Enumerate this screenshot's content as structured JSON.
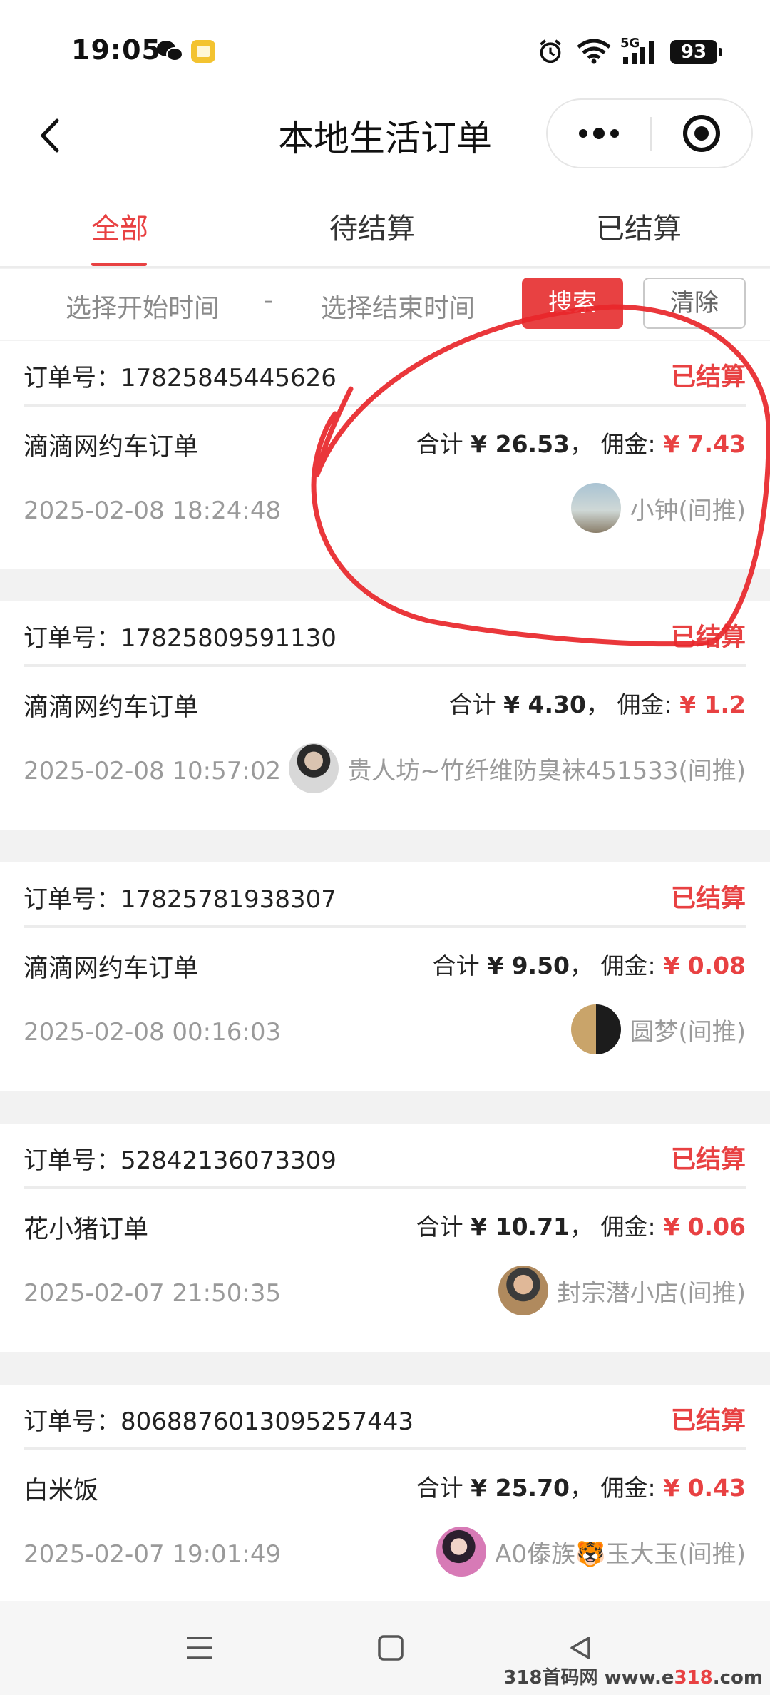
{
  "status_bar": {
    "time": "19:05",
    "network": "5G",
    "battery": "93"
  },
  "nav": {
    "title": "本地生活订单"
  },
  "tabs": [
    {
      "label": "全部",
      "active": true
    },
    {
      "label": "待结算",
      "active": false
    },
    {
      "label": "已结算",
      "active": false
    }
  ],
  "filter": {
    "start_placeholder": "选择开始时间",
    "separator": "-",
    "end_placeholder": "选择结束时间",
    "search_label": "搜索",
    "clear_label": "清除"
  },
  "labels": {
    "order_no": "订单号：",
    "total": "合计 ",
    "commission": "， 佣金: "
  },
  "orders": [
    {
      "order_no": "17825845445626",
      "status": "已结算",
      "name": "滴滴网约车订单",
      "total": "¥ 26.53",
      "commission": "¥ 7.43",
      "time": "2025-02-08 18:24:48",
      "user": "小钟(间推)"
    },
    {
      "order_no": "17825809591130",
      "status": "已结算",
      "name": "滴滴网约车订单",
      "total": "¥ 4.30",
      "commission": "¥ 1.2",
      "time": "2025-02-08 10:57:02",
      "user": "贵人坊~竹纤维防臭袜451533(间推)"
    },
    {
      "order_no": "17825781938307",
      "status": "已结算",
      "name": "滴滴网约车订单",
      "total": "¥ 9.50",
      "commission": "¥ 0.08",
      "time": "2025-02-08 00:16:03",
      "user": "圆梦(间推)"
    },
    {
      "order_no": "52842136073309",
      "status": "已结算",
      "name": "花小猪订单",
      "total": "¥ 10.71",
      "commission": "¥ 0.06",
      "time": "2025-02-07 21:50:35",
      "user": "封宗潜小店(间推)"
    },
    {
      "order_no": "8068876013095257443",
      "status": "已结算",
      "name": "白米饭",
      "total": "¥ 25.70",
      "commission": "¥ 0.43",
      "time": "2025-02-07 19:01:49",
      "user": "A0傣族🐯玉大玉(间推)"
    }
  ],
  "watermark": {
    "prefix": "318首码网 ",
    "site": "www.e",
    "num": "318",
    "suffix": ".com"
  },
  "colors": {
    "accent": "#e84142",
    "annotation": "#e8262a"
  }
}
